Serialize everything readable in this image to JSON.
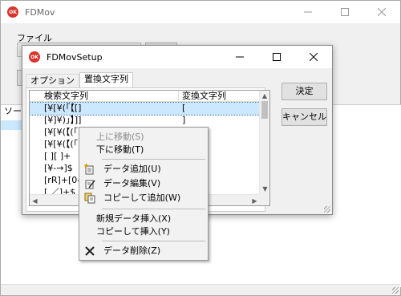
{
  "main_window": {
    "title": "FDMov",
    "icon_text": "OK",
    "menu_label": "ファイル",
    "list_header": "ソー"
  },
  "dialog": {
    "title": "FDMovSetup",
    "icon_text": "OK",
    "tabs": [
      {
        "label": "オプション",
        "active": false
      },
      {
        "label": "置換文字列",
        "active": true
      }
    ],
    "columns": [
      "検索文字列",
      "変換文字列"
    ],
    "rows": [
      {
        "search": "[¥[¥(「【[]",
        "replace": "[",
        "selected": true
      },
      {
        "search": "[¥]¥)」】]]",
        "replace": "]",
        "selected": false
      },
      {
        "search": "[¥[¥(【(「[]+第?(?)巻?(?)[]",
        "replace": "",
        "selected": false
      },
      {
        "search": "[¥[¥(【(「[](?",
        "replace": "",
        "selected": false
      },
      {
        "search": "[ ][ ]+",
        "replace": "",
        "selected": false
      },
      {
        "search": "[¥-→]$",
        "replace": "",
        "selected": false
      },
      {
        "search": "[rR]+[0-9]¥",
        "replace": "",
        "selected": false
      },
      {
        "search": "[ ／]+$",
        "replace": "",
        "selected": false
      }
    ],
    "buttons": {
      "ok": "決定",
      "cancel": "キャンセル"
    }
  },
  "context_menu": {
    "items": [
      {
        "label": "上に移動(S)",
        "disabled": true,
        "icon": null
      },
      {
        "label": "下に移動(T)",
        "disabled": false,
        "icon": null
      },
      {
        "label": "データ追加(U)",
        "disabled": false,
        "icon": "add-data-icon"
      },
      {
        "label": "データ編集(V)",
        "disabled": false,
        "icon": "edit-data-icon"
      },
      {
        "label": "コピーして追加(W)",
        "disabled": false,
        "icon": "copy-add-icon"
      },
      {
        "label": "新規データ挿入(X)",
        "disabled": false,
        "icon": null
      },
      {
        "label": "コピーして挿入(Y)",
        "disabled": false,
        "icon": null
      },
      {
        "label": "データ削除(Z)",
        "disabled": false,
        "icon": "delete-x-icon"
      }
    ]
  },
  "colors": {
    "selection": "#cce8ff",
    "app_icon": "#d9342b",
    "window_bg": "#f0f0f0"
  }
}
